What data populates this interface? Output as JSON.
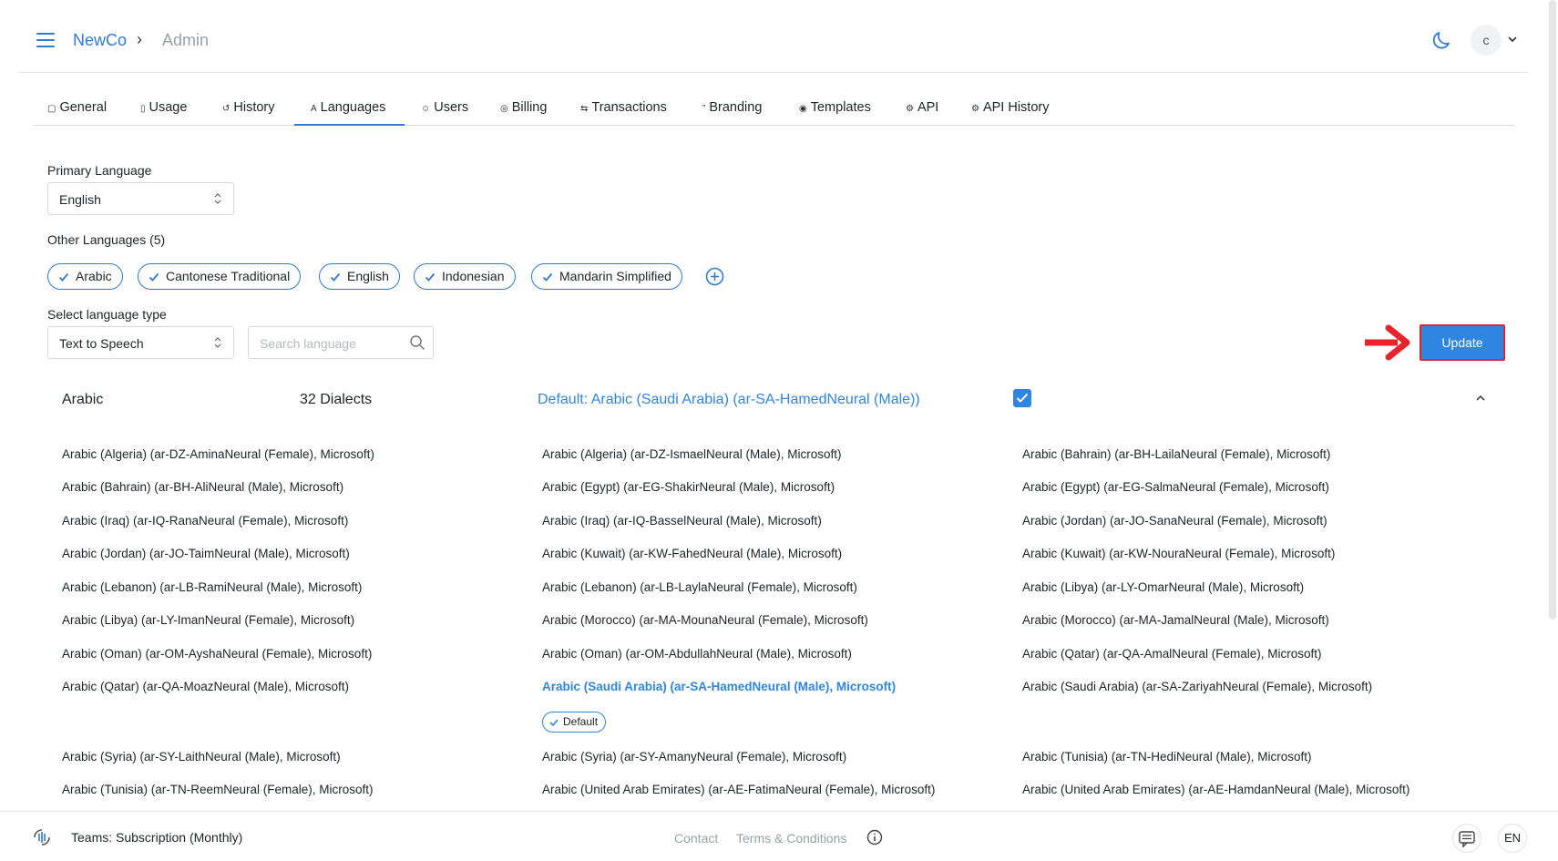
{
  "header": {
    "breadcrumb_root": "NewCo",
    "breadcrumb_current": "Admin",
    "avatar_initial": "c"
  },
  "tabs": [
    {
      "label": "General",
      "icon": "file-icon"
    },
    {
      "label": "Usage",
      "icon": "battery-icon"
    },
    {
      "label": "History",
      "icon": "history-icon"
    },
    {
      "label": "Languages",
      "icon": "translate-icon",
      "active": true
    },
    {
      "label": "Users",
      "icon": "user-icon"
    },
    {
      "label": "Billing",
      "icon": "billing-icon"
    },
    {
      "label": "Transactions",
      "icon": "transactions-icon"
    },
    {
      "label": "Branding",
      "icon": "quote-icon"
    },
    {
      "label": "Templates",
      "icon": "templates-icon"
    },
    {
      "label": "API",
      "icon": "api-icon"
    },
    {
      "label": "API History",
      "icon": "api-icon"
    }
  ],
  "form": {
    "primary_language_label": "Primary Language",
    "primary_language_value": "English",
    "other_languages_label": "Other Languages (5)",
    "other_languages": [
      "Arabic",
      "Cantonese Traditional",
      "English",
      "Indonesian",
      "Mandarin Simplified"
    ],
    "language_type_label": "Select language type",
    "language_type_value": "Text to Speech",
    "search_placeholder": "Search language",
    "update_label": "Update"
  },
  "language_section": {
    "name": "Arabic",
    "dialects": "32 Dialects",
    "default_text": "Default: Arabic (Saudi Arabia) (ar-SA-HamedNeural (Male))",
    "default_badge": "Default",
    "voices": [
      [
        "Arabic (Algeria) (ar-DZ-AminaNeural (Female), Microsoft)",
        "Arabic (Algeria) (ar-DZ-IsmaelNeural (Male), Microsoft)",
        "Arabic (Bahrain) (ar-BH-LailaNeural (Female), Microsoft)"
      ],
      [
        "Arabic (Bahrain) (ar-BH-AliNeural (Male), Microsoft)",
        "Arabic (Egypt) (ar-EG-ShakirNeural (Male), Microsoft)",
        "Arabic (Egypt) (ar-EG-SalmaNeural (Female), Microsoft)"
      ],
      [
        "Arabic (Iraq) (ar-IQ-RanaNeural (Female), Microsoft)",
        "Arabic (Iraq) (ar-IQ-BasselNeural (Male), Microsoft)",
        "Arabic (Jordan) (ar-JO-SanaNeural (Female), Microsoft)"
      ],
      [
        "Arabic (Jordan) (ar-JO-TaimNeural (Male), Microsoft)",
        "Arabic (Kuwait) (ar-KW-FahedNeural (Male), Microsoft)",
        "Arabic (Kuwait) (ar-KW-NouraNeural (Female), Microsoft)"
      ],
      [
        "Arabic (Lebanon) (ar-LB-RamiNeural (Male), Microsoft)",
        "Arabic (Lebanon) (ar-LB-LaylaNeural (Female), Microsoft)",
        "Arabic (Libya) (ar-LY-OmarNeural (Male), Microsoft)"
      ],
      [
        "Arabic (Libya) (ar-LY-ImanNeural (Female), Microsoft)",
        "Arabic (Morocco) (ar-MA-MounaNeural (Female), Microsoft)",
        "Arabic (Morocco) (ar-MA-JamalNeural (Male), Microsoft)"
      ],
      [
        "Arabic (Oman) (ar-OM-AyshaNeural (Female), Microsoft)",
        "Arabic (Oman) (ar-OM-AbdullahNeural (Male), Microsoft)",
        "Arabic (Qatar) (ar-QA-AmalNeural (Female), Microsoft)"
      ],
      [
        "Arabic (Qatar) (ar-QA-MoazNeural (Male), Microsoft)",
        "Arabic (Saudi Arabia) (ar-SA-HamedNeural (Male), Microsoft)",
        "Arabic (Saudi Arabia) (ar-SA-ZariyahNeural (Female), Microsoft)"
      ],
      [
        "Arabic (Syria) (ar-SY-LaithNeural (Male), Microsoft)",
        "Arabic (Syria) (ar-SY-AmanyNeural (Female), Microsoft)",
        "Arabic (Tunisia) (ar-TN-HediNeural (Male), Microsoft)"
      ],
      [
        "Arabic (Tunisia) (ar-TN-ReemNeural (Female), Microsoft)",
        "Arabic (United Arab Emirates) (ar-AE-FatimaNeural (Female), Microsoft)",
        "Arabic (United Arab Emirates) (ar-AE-HamdanNeural (Male), Microsoft)"
      ]
    ]
  },
  "footer": {
    "plan": "Teams: Subscription (Monthly)",
    "contact": "Contact",
    "terms": "Terms & Conditions",
    "lang": "EN"
  },
  "colors": {
    "accent": "#2f86e0",
    "highlight_border": "#e0262a",
    "arrow": "#e8232a"
  }
}
